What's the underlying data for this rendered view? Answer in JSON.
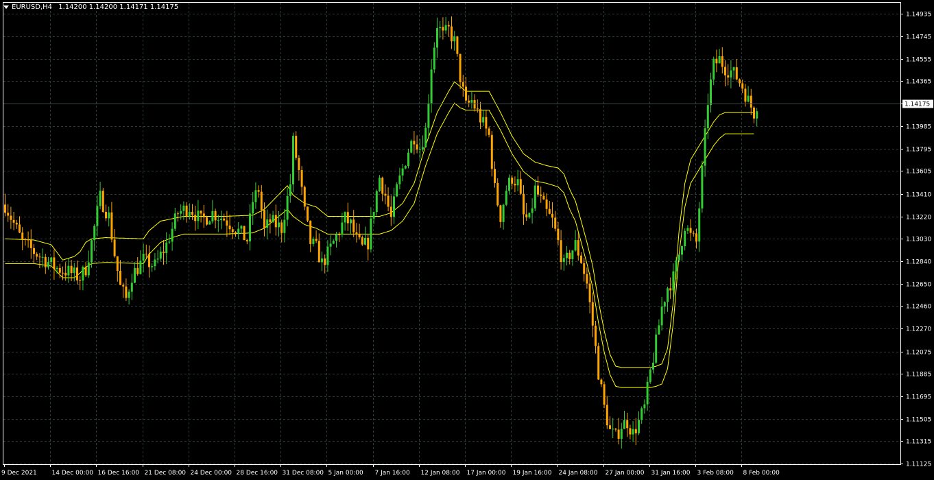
{
  "header": {
    "symbol": "EURUSD,H4",
    "open": "1.14200",
    "high": "1.14200",
    "low": "1.14171",
    "close": "1.14175"
  },
  "colors": {
    "background": "#000000",
    "grid": "#2e3b3b",
    "frame": "#ffffff",
    "bull": "#32cd32",
    "bear": "#ffa500",
    "envelope": "#ffff00",
    "text": "#ffffff",
    "price_label_bg": "#ffffff",
    "price_label_text": "#000000"
  },
  "chart_data": {
    "type": "candlestick",
    "symbol": "EURUSD",
    "timeframe": "H4",
    "ylim": [
      1.1112,
      1.1503
    ],
    "current_price": "1.14175",
    "y_ticks": [
      "1.14935",
      "1.14745",
      "1.14555",
      "1.14365",
      "1.14175",
      "1.13985",
      "1.13795",
      "1.13605",
      "1.13410",
      "1.13220",
      "1.13030",
      "1.12840",
      "1.12650",
      "1.12460",
      "1.12270",
      "1.12075",
      "1.11885",
      "1.11695",
      "1.11505",
      "1.11315",
      "1.11125"
    ],
    "x_ticks": [
      {
        "label": "9 Dec 2021",
        "bar": 0
      },
      {
        "label": "14 Dec 00:00",
        "bar": 16
      },
      {
        "label": "16 Dec 16:00",
        "bar": 32
      },
      {
        "label": "21 Dec 08:00",
        "bar": 48
      },
      {
        "label": "24 Dec 00:00",
        "bar": 64
      },
      {
        "label": "28 Dec 16:00",
        "bar": 80
      },
      {
        "label": "31 Dec 08:00",
        "bar": 96
      },
      {
        "label": "5 Jan 00:00",
        "bar": 112
      },
      {
        "label": "7 Jan 16:00",
        "bar": 128
      },
      {
        "label": "12 Jan 08:00",
        "bar": 144
      },
      {
        "label": "17 Jan 00:00",
        "bar": 160
      },
      {
        "label": "19 Jan 16:00",
        "bar": 176
      },
      {
        "label": "24 Jan 08:00",
        "bar": 192
      },
      {
        "label": "27 Jan 00:00",
        "bar": 208
      },
      {
        "label": "31 Jan 16:00",
        "bar": 224
      },
      {
        "label": "3 Feb 08:00",
        "bar": 240
      },
      {
        "label": "8 Feb 00:00",
        "bar": 256
      }
    ],
    "bars": 262,
    "close_path": [
      [
        0,
        1.1332
      ],
      [
        6,
        1.13
      ],
      [
        10,
        1.1292
      ],
      [
        14,
        1.1285
      ],
      [
        18,
        1.1278
      ],
      [
        22,
        1.1275
      ],
      [
        26,
        1.127
      ],
      [
        28,
        1.1278
      ],
      [
        30,
        1.13
      ],
      [
        33,
        1.1338
      ],
      [
        36,
        1.1322
      ],
      [
        38,
        1.129
      ],
      [
        40,
        1.1262
      ],
      [
        42,
        1.1252
      ],
      [
        44,
        1.1272
      ],
      [
        48,
        1.1285
      ],
      [
        52,
        1.128
      ],
      [
        56,
        1.1298
      ],
      [
        60,
        1.1325
      ],
      [
        64,
        1.133
      ],
      [
        68,
        1.1318
      ],
      [
        72,
        1.1325
      ],
      [
        76,
        1.132
      ],
      [
        80,
        1.1312
      ],
      [
        84,
        1.1302
      ],
      [
        86,
        1.1335
      ],
      [
        88,
        1.1345
      ],
      [
        90,
        1.131
      ],
      [
        92,
        1.1318
      ],
      [
        96,
        1.1312
      ],
      [
        99,
        1.135
      ],
      [
        100,
        1.1385
      ],
      [
        102,
        1.136
      ],
      [
        104,
        1.1325
      ],
      [
        106,
        1.13
      ],
      [
        108,
        1.1295
      ],
      [
        110,
        1.1282
      ],
      [
        112,
        1.129
      ],
      [
        116,
        1.131
      ],
      [
        118,
        1.132
      ],
      [
        120,
        1.1315
      ],
      [
        122,
        1.1302
      ],
      [
        124,
        1.1295
      ],
      [
        126,
        1.13
      ],
      [
        128,
        1.133
      ],
      [
        130,
        1.1355
      ],
      [
        132,
        1.134
      ],
      [
        134,
        1.132
      ],
      [
        136,
        1.1345
      ],
      [
        138,
        1.1362
      ],
      [
        140,
        1.1378
      ],
      [
        142,
        1.139
      ],
      [
        144,
        1.138
      ],
      [
        146,
        1.1395
      ],
      [
        148,
        1.145
      ],
      [
        150,
        1.1485
      ],
      [
        152,
        1.1475
      ],
      [
        154,
        1.148
      ],
      [
        156,
        1.147
      ],
      [
        158,
        1.144
      ],
      [
        160,
        1.1415
      ],
      [
        162,
        1.142
      ],
      [
        164,
        1.141
      ],
      [
        166,
        1.14
      ],
      [
        168,
        1.139
      ],
      [
        170,
        1.1345
      ],
      [
        172,
        1.1322
      ],
      [
        174,
        1.1345
      ],
      [
        176,
        1.1355
      ],
      [
        178,
        1.135
      ],
      [
        180,
        1.1322
      ],
      [
        182,
        1.1318
      ],
      [
        184,
        1.1345
      ],
      [
        186,
        1.1335
      ],
      [
        188,
        1.1325
      ],
      [
        190,
        1.1318
      ],
      [
        192,
        1.13
      ],
      [
        194,
        1.128
      ],
      [
        196,
        1.129
      ],
      [
        198,
        1.1298
      ],
      [
        200,
        1.1285
      ],
      [
        202,
        1.1265
      ],
      [
        204,
        1.123
      ],
      [
        206,
        1.119
      ],
      [
        208,
        1.116
      ],
      [
        210,
        1.114
      ],
      [
        212,
        1.1135
      ],
      [
        214,
        1.1145
      ],
      [
        216,
        1.1148
      ],
      [
        218,
        1.1138
      ],
      [
        220,
        1.1148
      ],
      [
        222,
        1.116
      ],
      [
        224,
        1.119
      ],
      [
        226,
        1.1215
      ],
      [
        228,
        1.1245
      ],
      [
        230,
        1.1262
      ],
      [
        232,
        1.127
      ],
      [
        234,
        1.129
      ],
      [
        236,
        1.1315
      ],
      [
        238,
        1.1305
      ],
      [
        240,
        1.13
      ],
      [
        242,
        1.136
      ],
      [
        244,
        1.142
      ],
      [
        246,
        1.145
      ],
      [
        248,
        1.1455
      ],
      [
        250,
        1.1448
      ],
      [
        252,
        1.1445
      ],
      [
        254,
        1.144
      ],
      [
        256,
        1.1432
      ],
      [
        258,
        1.142
      ],
      [
        260,
        1.141
      ],
      [
        261,
        1.14175
      ]
    ],
    "envelope_upper_path": [
      [
        0,
        1.1303
      ],
      [
        10,
        1.1302
      ],
      [
        16,
        1.1298
      ],
      [
        20,
        1.1285
      ],
      [
        24,
        1.1288
      ],
      [
        26,
        1.1292
      ],
      [
        28,
        1.13
      ],
      [
        30,
        1.1303
      ],
      [
        35,
        1.1304
      ],
      [
        48,
        1.1303
      ],
      [
        50,
        1.131
      ],
      [
        54,
        1.1318
      ],
      [
        58,
        1.132
      ],
      [
        62,
        1.1322
      ],
      [
        66,
        1.1322
      ],
      [
        70,
        1.1322
      ],
      [
        76,
        1.1322
      ],
      [
        86,
        1.1323
      ],
      [
        90,
        1.1328
      ],
      [
        94,
        1.1338
      ],
      [
        98,
        1.1348
      ],
      [
        100,
        1.134
      ],
      [
        104,
        1.1333
      ],
      [
        108,
        1.133
      ],
      [
        112,
        1.1322
      ],
      [
        116,
        1.1322
      ],
      [
        120,
        1.1322
      ],
      [
        126,
        1.1322
      ],
      [
        130,
        1.1322
      ],
      [
        134,
        1.1325
      ],
      [
        138,
        1.1333
      ],
      [
        142,
        1.135
      ],
      [
        146,
        1.1382
      ],
      [
        150,
        1.141
      ],
      [
        154,
        1.1428
      ],
      [
        156,
        1.1436
      ],
      [
        158,
        1.1432
      ],
      [
        160,
        1.1428
      ],
      [
        164,
        1.1428
      ],
      [
        168,
        1.1428
      ],
      [
        172,
        1.141
      ],
      [
        176,
        1.139
      ],
      [
        180,
        1.1375
      ],
      [
        184,
        1.1368
      ],
      [
        188,
        1.1365
      ],
      [
        192,
        1.1363
      ],
      [
        194,
        1.1358
      ],
      [
        196,
        1.1345
      ],
      [
        198,
        1.1335
      ],
      [
        200,
        1.1318
      ],
      [
        202,
        1.13
      ],
      [
        204,
        1.128
      ],
      [
        206,
        1.125
      ],
      [
        208,
        1.1225
      ],
      [
        210,
        1.1205
      ],
      [
        212,
        1.1195
      ],
      [
        214,
        1.1194
      ],
      [
        216,
        1.1194
      ],
      [
        218,
        1.1194
      ],
      [
        220,
        1.1194
      ],
      [
        222,
        1.1194
      ],
      [
        224,
        1.1194
      ],
      [
        226,
        1.1195
      ],
      [
        228,
        1.1197
      ],
      [
        230,
        1.121
      ],
      [
        232,
        1.125
      ],
      [
        234,
        1.131
      ],
      [
        236,
        1.135
      ],
      [
        238,
        1.137
      ],
      [
        240,
        1.1378
      ],
      [
        242,
        1.1386
      ],
      [
        244,
        1.1394
      ],
      [
        246,
        1.1402
      ],
      [
        248,
        1.1408
      ],
      [
        250,
        1.141
      ],
      [
        252,
        1.141
      ],
      [
        254,
        1.141
      ],
      [
        256,
        1.141
      ],
      [
        258,
        1.141
      ],
      [
        260,
        1.141
      ]
    ],
    "envelope_lower_path": [
      [
        0,
        1.1282
      ],
      [
        10,
        1.1282
      ],
      [
        16,
        1.128
      ],
      [
        20,
        1.127
      ],
      [
        24,
        1.127
      ],
      [
        26,
        1.1274
      ],
      [
        28,
        1.1279
      ],
      [
        30,
        1.1282
      ],
      [
        35,
        1.1283
      ],
      [
        48,
        1.1282
      ],
      [
        50,
        1.129
      ],
      [
        54,
        1.13
      ],
      [
        58,
        1.1304
      ],
      [
        62,
        1.1307
      ],
      [
        66,
        1.1307
      ],
      [
        70,
        1.1307
      ],
      [
        76,
        1.1307
      ],
      [
        86,
        1.1308
      ],
      [
        90,
        1.1312
      ],
      [
        94,
        1.132
      ],
      [
        98,
        1.1328
      ],
      [
        100,
        1.1322
      ],
      [
        104,
        1.1315
      ],
      [
        108,
        1.1312
      ],
      [
        112,
        1.1307
      ],
      [
        116,
        1.1307
      ],
      [
        120,
        1.1307
      ],
      [
        126,
        1.1307
      ],
      [
        130,
        1.1307
      ],
      [
        134,
        1.131
      ],
      [
        138,
        1.1318
      ],
      [
        142,
        1.1333
      ],
      [
        146,
        1.1365
      ],
      [
        150,
        1.1392
      ],
      [
        154,
        1.141
      ],
      [
        156,
        1.1418
      ],
      [
        158,
        1.1414
      ],
      [
        160,
        1.1412
      ],
      [
        164,
        1.1412
      ],
      [
        168,
        1.1412
      ],
      [
        172,
        1.1395
      ],
      [
        176,
        1.1375
      ],
      [
        180,
        1.136
      ],
      [
        184,
        1.1352
      ],
      [
        188,
        1.135
      ],
      [
        192,
        1.1347
      ],
      [
        194,
        1.1342
      ],
      [
        196,
        1.1328
      ],
      [
        198,
        1.1318
      ],
      [
        200,
        1.13
      ],
      [
        202,
        1.1282
      ],
      [
        204,
        1.1262
      ],
      [
        206,
        1.1232
      ],
      [
        208,
        1.1207
      ],
      [
        210,
        1.1188
      ],
      [
        212,
        1.1178
      ],
      [
        214,
        1.1177
      ],
      [
        216,
        1.1177
      ],
      [
        218,
        1.1177
      ],
      [
        220,
        1.1177
      ],
      [
        222,
        1.1177
      ],
      [
        224,
        1.1177
      ],
      [
        226,
        1.1178
      ],
      [
        228,
        1.118
      ],
      [
        230,
        1.1193
      ],
      [
        232,
        1.1232
      ],
      [
        234,
        1.129
      ],
      [
        236,
        1.133
      ],
      [
        238,
        1.135
      ],
      [
        240,
        1.1358
      ],
      [
        242,
        1.1366
      ],
      [
        244,
        1.1374
      ],
      [
        246,
        1.1382
      ],
      [
        248,
        1.1388
      ],
      [
        250,
        1.1392
      ],
      [
        252,
        1.1392
      ],
      [
        254,
        1.1392
      ],
      [
        256,
        1.1392
      ],
      [
        258,
        1.1392
      ],
      [
        260,
        1.1392
      ]
    ]
  }
}
